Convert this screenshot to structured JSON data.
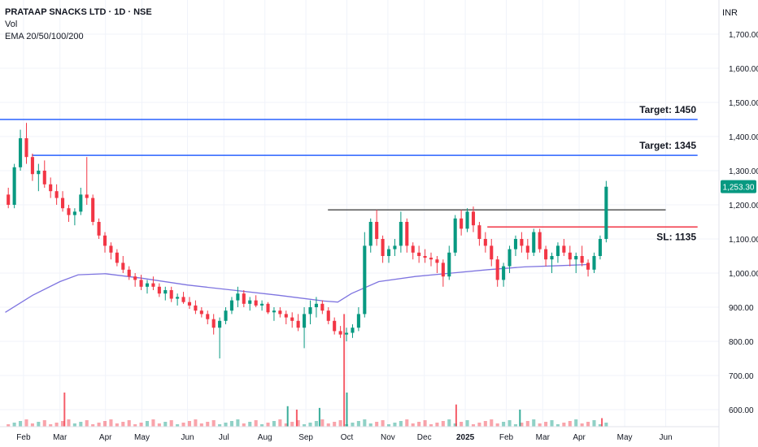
{
  "header": {
    "title": "PRATAAP SNACKS LTD · 1D · NSE",
    "vol_label": "Vol",
    "ema_label": "EMA 20/50/100/200",
    "currency": "INR"
  },
  "chart_data": {
    "type": "candlestick",
    "symbol": "PRATAAP SNACKS LTD",
    "interval": "1D",
    "exchange": "NSE",
    "ylim": [
      550,
      1800
    ],
    "y_ticks": [
      {
        "value": 1700,
        "label": "1,700.00"
      },
      {
        "value": 1600,
        "label": "1,600.00"
      },
      {
        "value": 1500,
        "label": "1,500.00"
      },
      {
        "value": 1400,
        "label": "1,400.00"
      },
      {
        "value": 1300,
        "label": "1,300.00"
      },
      {
        "value": 1200,
        "label": "1,200.00"
      },
      {
        "value": 1100,
        "label": "1,100.00"
      },
      {
        "value": 1000,
        "label": "1,000.00"
      },
      {
        "value": 900,
        "label": "900.00"
      },
      {
        "value": 800,
        "label": "800.00"
      },
      {
        "value": 700,
        "label": "700.00"
      },
      {
        "value": 600,
        "label": "600.00"
      }
    ],
    "x_ticks": [
      {
        "week": 2,
        "label": "Feb",
        "bold": false
      },
      {
        "week": 6,
        "label": "Mar",
        "bold": false
      },
      {
        "week": 11,
        "label": "Apr",
        "bold": false
      },
      {
        "week": 15,
        "label": "May",
        "bold": false
      },
      {
        "week": 20,
        "label": "Jun",
        "bold": false
      },
      {
        "week": 24,
        "label": "Jul",
        "bold": false
      },
      {
        "week": 28.5,
        "label": "Aug",
        "bold": false
      },
      {
        "week": 33,
        "label": "Sep",
        "bold": false
      },
      {
        "week": 37.5,
        "label": "Oct",
        "bold": false
      },
      {
        "week": 42,
        "label": "Nov",
        "bold": false
      },
      {
        "week": 46,
        "label": "Dec",
        "bold": false
      },
      {
        "week": 50.5,
        "label": "2025",
        "bold": true
      },
      {
        "week": 55,
        "label": "Feb",
        "bold": false
      },
      {
        "week": 59,
        "label": "Mar",
        "bold": false
      },
      {
        "week": 63,
        "label": "Apr",
        "bold": false
      },
      {
        "week": 68,
        "label": "May",
        "bold": false
      },
      {
        "week": 72.5,
        "label": "Jun",
        "bold": false
      }
    ],
    "last_price": {
      "value": 1253.3,
      "label": "1,253.30",
      "color": "#089981"
    },
    "levels": [
      {
        "value": 1450,
        "label": "Target: 1450",
        "color": "#2962ff",
        "from_week": 0,
        "to_week": 76
      },
      {
        "value": 1345,
        "label": "Target: 1345",
        "color": "#2962ff",
        "from_week": 3.5,
        "to_week": 76
      },
      {
        "value": 1185,
        "label": "",
        "color": "#555555",
        "from_week": 36,
        "to_week": 72.5
      },
      {
        "value": 1135,
        "label": "SL: 1135",
        "color": "#f23645",
        "from_week": 53.5,
        "to_week": 76
      }
    ],
    "ema_series": {
      "name": "EMA 20/50/100/200",
      "color": "#7e74e0",
      "points": [
        [
          0,
          885
        ],
        [
          3,
          935
        ],
        [
          6,
          975
        ],
        [
          8,
          995
        ],
        [
          11,
          998
        ],
        [
          15,
          985
        ],
        [
          20,
          965
        ],
        [
          25,
          950
        ],
        [
          30,
          935
        ],
        [
          35,
          918
        ],
        [
          36.5,
          915
        ],
        [
          38,
          940
        ],
        [
          41,
          975
        ],
        [
          45,
          990
        ],
        [
          49,
          1000
        ],
        [
          53,
          1010
        ],
        [
          57,
          1018
        ],
        [
          61,
          1022
        ],
        [
          64,
          1025
        ]
      ]
    },
    "colors": {
      "up": "#089981",
      "down": "#f23645"
    },
    "volume_spikes": [
      {
        "week": 6.5,
        "value": 1.0
      },
      {
        "week": 31.0,
        "value": 0.6
      },
      {
        "week": 32.0,
        "value": 0.5
      },
      {
        "week": 34.5,
        "value": 0.55
      },
      {
        "week": 37.2,
        "value": 3.3
      },
      {
        "week": 37.5,
        "value": 1.0
      },
      {
        "week": 49.5,
        "value": 0.65
      },
      {
        "week": 56.5,
        "value": 0.5
      },
      {
        "week": 65.5,
        "value": 0.25
      }
    ],
    "candles": [
      [
        1230,
        1250,
        1190,
        1200
      ],
      [
        1200,
        1320,
        1190,
        1310
      ],
      [
        1310,
        1420,
        1300,
        1395
      ],
      [
        1395,
        1440,
        1320,
        1340
      ],
      [
        1340,
        1350,
        1270,
        1290
      ],
      [
        1290,
        1320,
        1240,
        1300
      ],
      [
        1300,
        1330,
        1250,
        1260
      ],
      [
        1260,
        1280,
        1220,
        1240
      ],
      [
        1240,
        1260,
        1200,
        1220
      ],
      [
        1220,
        1240,
        1180,
        1190
      ],
      [
        1190,
        1200,
        1150,
        1170
      ],
      [
        1170,
        1190,
        1140,
        1180
      ],
      [
        1180,
        1250,
        1170,
        1230
      ],
      [
        1230,
        1340,
        1200,
        1220
      ],
      [
        1220,
        1230,
        1140,
        1150
      ],
      [
        1150,
        1160,
        1100,
        1110
      ],
      [
        1110,
        1120,
        1060,
        1080
      ],
      [
        1080,
        1090,
        1040,
        1060
      ],
      [
        1060,
        1070,
        1020,
        1030
      ],
      [
        1030,
        1050,
        1000,
        1010
      ],
      [
        1010,
        1020,
        980,
        990
      ],
      [
        990,
        1000,
        960,
        980
      ],
      [
        980,
        995,
        950,
        960
      ],
      [
        960,
        980,
        940,
        970
      ],
      [
        970,
        990,
        950,
        960
      ],
      [
        960,
        970,
        930,
        940
      ],
      [
        940,
        960,
        920,
        950
      ],
      [
        950,
        960,
        915,
        925
      ],
      [
        925,
        940,
        905,
        930
      ],
      [
        930,
        945,
        910,
        915
      ],
      [
        915,
        930,
        895,
        905
      ],
      [
        905,
        920,
        880,
        890
      ],
      [
        890,
        900,
        870,
        880
      ],
      [
        880,
        890,
        850,
        865
      ],
      [
        865,
        880,
        820,
        840
      ],
      [
        840,
        870,
        750,
        860
      ],
      [
        860,
        900,
        850,
        890
      ],
      [
        890,
        930,
        880,
        920
      ],
      [
        920,
        960,
        900,
        940
      ],
      [
        940,
        950,
        900,
        910
      ],
      [
        910,
        930,
        890,
        920
      ],
      [
        920,
        935,
        900,
        905
      ],
      [
        905,
        920,
        890,
        910
      ],
      [
        910,
        915,
        880,
        885
      ],
      [
        885,
        900,
        860,
        890
      ],
      [
        890,
        900,
        870,
        880
      ],
      [
        880,
        890,
        850,
        870
      ],
      [
        870,
        885,
        840,
        860
      ],
      [
        860,
        880,
        830,
        840
      ],
      [
        840,
        900,
        780,
        880
      ],
      [
        880,
        920,
        850,
        900
      ],
      [
        900,
        930,
        870,
        910
      ],
      [
        910,
        920,
        880,
        890
      ],
      [
        890,
        900,
        850,
        860
      ],
      [
        860,
        870,
        820,
        830
      ],
      [
        830,
        845,
        810,
        820
      ],
      [
        820,
        840,
        800,
        825
      ],
      [
        825,
        850,
        810,
        840
      ],
      [
        840,
        900,
        830,
        880
      ],
      [
        880,
        1120,
        870,
        1080
      ],
      [
        1080,
        1160,
        1060,
        1150
      ],
      [
        1150,
        1185,
        1080,
        1100
      ],
      [
        1100,
        1110,
        1030,
        1050
      ],
      [
        1050,
        1080,
        1030,
        1070
      ],
      [
        1070,
        1100,
        1050,
        1080
      ],
      [
        1080,
        1180,
        1060,
        1150
      ],
      [
        1150,
        1160,
        1060,
        1080
      ],
      [
        1080,
        1090,
        1040,
        1060
      ],
      [
        1060,
        1080,
        1030,
        1050
      ],
      [
        1050,
        1070,
        1030,
        1045
      ],
      [
        1045,
        1060,
        1020,
        1040
      ],
      [
        1040,
        1050,
        1000,
        1030
      ],
      [
        1030,
        1040,
        960,
        990
      ],
      [
        990,
        1080,
        980,
        1060
      ],
      [
        1060,
        1170,
        1050,
        1160
      ],
      [
        1160,
        1185,
        1110,
        1130
      ],
      [
        1130,
        1190,
        1120,
        1180
      ],
      [
        1180,
        1195,
        1120,
        1140
      ],
      [
        1140,
        1150,
        1080,
        1100
      ],
      [
        1100,
        1120,
        1060,
        1080
      ],
      [
        1080,
        1100,
        1020,
        1040
      ],
      [
        1040,
        1050,
        960,
        980
      ],
      [
        980,
        1030,
        960,
        1020
      ],
      [
        1020,
        1080,
        1000,
        1070
      ],
      [
        1070,
        1110,
        1050,
        1100
      ],
      [
        1100,
        1120,
        1060,
        1080
      ],
      [
        1080,
        1100,
        1040,
        1060
      ],
      [
        1060,
        1130,
        1050,
        1120
      ],
      [
        1120,
        1130,
        1060,
        1070
      ],
      [
        1070,
        1080,
        1020,
        1040
      ],
      [
        1040,
        1060,
        1000,
        1050
      ],
      [
        1050,
        1090,
        1030,
        1080
      ],
      [
        1080,
        1100,
        1050,
        1060
      ],
      [
        1060,
        1080,
        1020,
        1040
      ],
      [
        1040,
        1060,
        1000,
        1050
      ],
      [
        1050,
        1080,
        1020,
        1030
      ],
      [
        1030,
        1040,
        990,
        1010
      ],
      [
        1010,
        1060,
        1000,
        1050
      ],
      [
        1050,
        1110,
        1040,
        1100
      ],
      [
        1100,
        1270,
        1090,
        1253
      ]
    ]
  }
}
